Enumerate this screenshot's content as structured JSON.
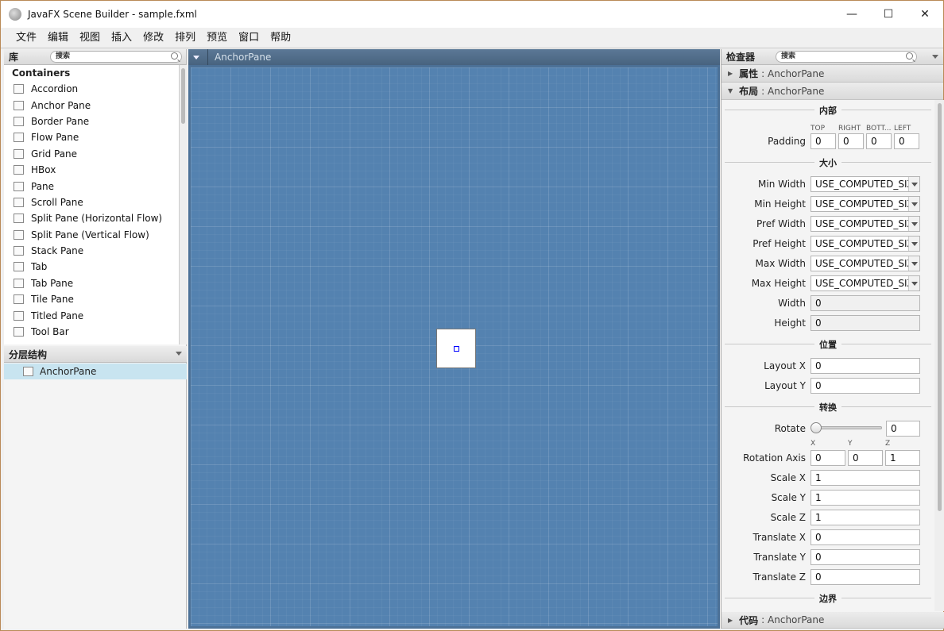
{
  "window": {
    "title": "JavaFX Scene Builder - sample.fxml",
    "minimize": "—",
    "maximize": "☐",
    "close": "✕"
  },
  "menu": [
    "文件",
    "编辑",
    "视图",
    "插入",
    "修改",
    "排列",
    "预览",
    "窗口",
    "帮助"
  ],
  "library": {
    "title": "库",
    "search_placeholder": "搜索",
    "section": "Containers",
    "items": [
      "Accordion",
      "Anchor Pane",
      "Border Pane",
      "Flow Pane",
      "Grid Pane",
      "HBox",
      "Pane",
      "Scroll Pane",
      "Split Pane (Horizontal Flow)",
      "Split Pane (Vertical Flow)",
      "Stack Pane",
      "Tab",
      "Tab Pane",
      "Tile Pane",
      "Titled Pane",
      "Tool Bar"
    ]
  },
  "hierarchy": {
    "title": "分层结构",
    "root": "AnchorPane"
  },
  "canvas": {
    "breadcrumb": "AnchorPane"
  },
  "inspector": {
    "title": "检查器",
    "search_placeholder": "搜索",
    "properties": {
      "label": "属性",
      "target": ": AnchorPane"
    },
    "layout": {
      "label": "布局",
      "target": ": AnchorPane"
    },
    "code": {
      "label": "代码",
      "target": ": AnchorPane"
    },
    "groups": {
      "inner": "内部",
      "size": "大小",
      "position": "位置",
      "transform": "转换",
      "border": "边界"
    },
    "padding": {
      "label": "Padding",
      "cols": [
        "TOP",
        "RIGHT",
        "BOTT...",
        "LEFT"
      ],
      "values": [
        "0",
        "0",
        "0",
        "0"
      ]
    },
    "size_rows": [
      {
        "label": "Min Width",
        "value": "USE_COMPUTED_SIZE"
      },
      {
        "label": "Min Height",
        "value": "USE_COMPUTED_SIZE"
      },
      {
        "label": "Pref Width",
        "value": "USE_COMPUTED_SIZE"
      },
      {
        "label": "Pref Height",
        "value": "USE_COMPUTED_SIZE"
      },
      {
        "label": "Max Width",
        "value": "USE_COMPUTED_SIZE"
      },
      {
        "label": "Max Height",
        "value": "USE_COMPUTED_SIZE"
      }
    ],
    "width": {
      "label": "Width",
      "value": "0"
    },
    "height": {
      "label": "Height",
      "value": "0"
    },
    "layout_x": {
      "label": "Layout X",
      "value": "0"
    },
    "layout_y": {
      "label": "Layout Y",
      "value": "0"
    },
    "rotate": {
      "label": "Rotate",
      "value": "0",
      "slider_fraction": 0
    },
    "rotation_axis": {
      "label": "Rotation Axis",
      "cols": [
        "X",
        "Y",
        "Z"
      ],
      "values": [
        "0",
        "0",
        "1"
      ]
    },
    "transform_rows": [
      {
        "label": "Scale X",
        "value": "1"
      },
      {
        "label": "Scale Y",
        "value": "1"
      },
      {
        "label": "Scale Z",
        "value": "1"
      },
      {
        "label": "Translate X",
        "value": "0"
      },
      {
        "label": "Translate Y",
        "value": "0"
      },
      {
        "label": "Translate Z",
        "value": "0"
      }
    ]
  }
}
